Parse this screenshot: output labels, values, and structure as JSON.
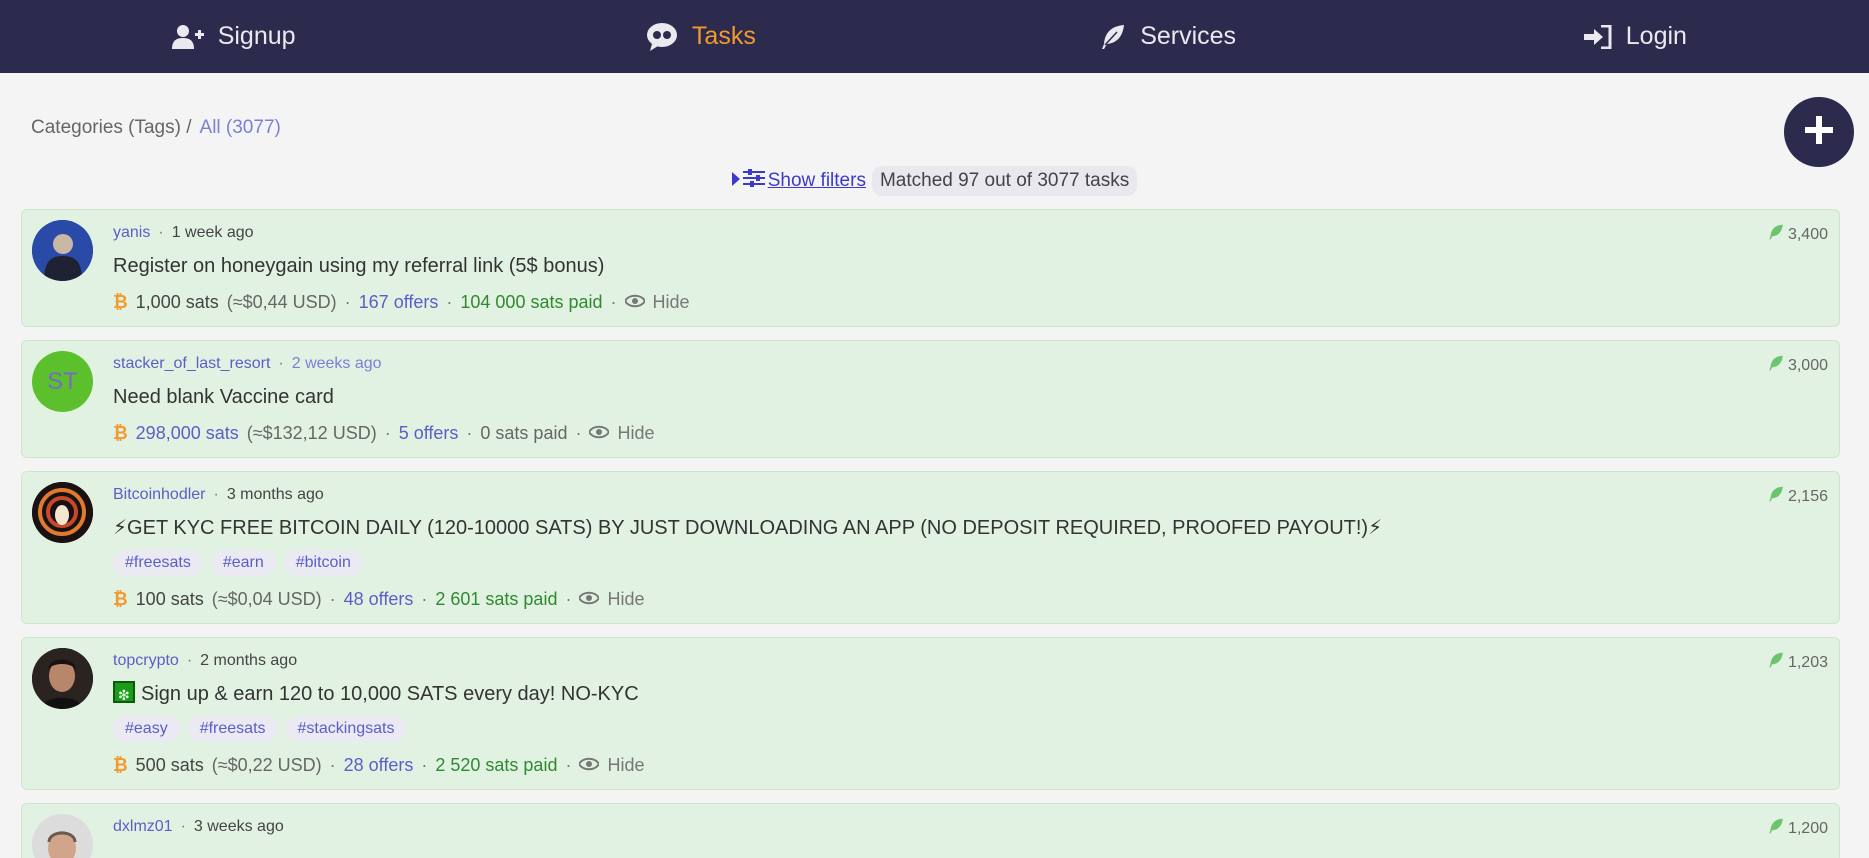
{
  "nav": {
    "signup": "Signup",
    "tasks": "Tasks",
    "services": "Services",
    "login": "Login",
    "active_color": "#f29a2e",
    "bg_color": "#2c2a4d"
  },
  "breadcrumb": {
    "root": "Categories (Tags) /",
    "current": "All (3077)"
  },
  "filters": {
    "show_label": "Show filters",
    "matched": "Matched 97 out of 3077 tasks"
  },
  "tasks": [
    {
      "user": "yanis",
      "time": "1 week ago",
      "title": "Register on honeygain using my referral link (5$ bonus)",
      "reward": "1,000 sats",
      "usd": "(≈$0,44 USD)",
      "offers": "167 offers",
      "paid": "104 000 sats paid",
      "hide": "Hide",
      "score": "3,400"
    },
    {
      "user": "stacker_of_last_resort",
      "time": "2 weeks ago",
      "initials": "ST",
      "title": "Need blank Vaccine card",
      "reward": "298,000 sats",
      "usd": "(≈$132,12 USD)",
      "offers": "5 offers",
      "paid": "0 sats paid",
      "hide": "Hide",
      "score": "3,000"
    },
    {
      "user": "Bitcoinhodler",
      "time": "3 months ago",
      "title": "⚡GET KYC FREE BITCOIN DAILY (120-10000 SATS) BY JUST DOWNLOADING AN APP (NO DEPOSIT REQUIRED, PROOFED PAYOUT!)⚡",
      "tags": [
        "#freesats",
        "#earn",
        "#bitcoin"
      ],
      "reward": "100 sats",
      "usd": "(≈$0,04 USD)",
      "offers": "48 offers",
      "paid": "2 601 sats paid",
      "hide": "Hide",
      "score": "2,156"
    },
    {
      "user": "topcrypto",
      "time": "2 months ago",
      "title": "Sign up & earn 120 to 10,000 SATS every day! NO-KYC",
      "tags": [
        "#easy",
        "#freesats",
        "#stackingsats"
      ],
      "reward": "500 sats",
      "usd": "(≈$0,22 USD)",
      "offers": "28 offers",
      "paid": "2 520 sats paid",
      "hide": "Hide",
      "score": "1,203"
    },
    {
      "user": "dxlmz01",
      "time": "3 weeks ago",
      "score": "1,200"
    }
  ]
}
